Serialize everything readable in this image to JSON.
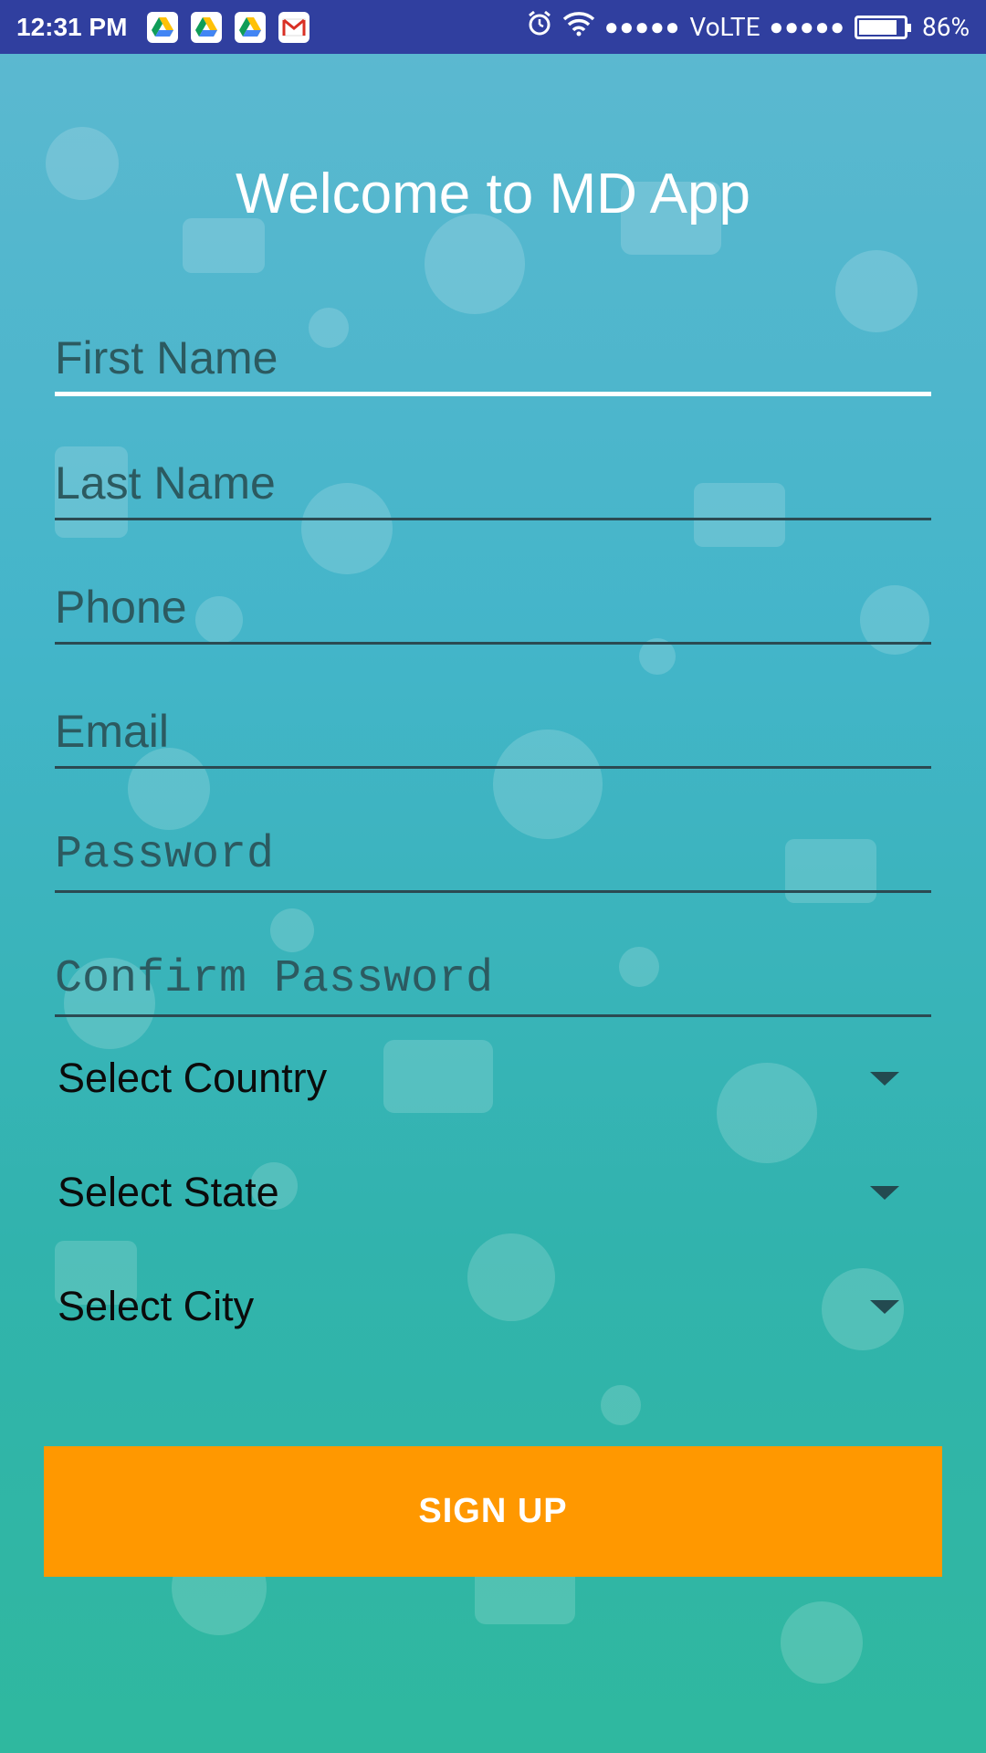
{
  "status_bar": {
    "time": "12:31 PM",
    "network": "VoLTE",
    "signal_dots_1": "●●●●●",
    "signal_dots_2": "●●●●●",
    "battery_percent": "86%",
    "battery_level": 0.86,
    "icons": [
      "drive-icon",
      "drive-icon",
      "drive-icon",
      "gmail-icon",
      "alarm-icon",
      "wifi-icon"
    ]
  },
  "welcome_title": "Welcome to MD App",
  "form": {
    "first_name_placeholder": "First Name",
    "last_name_placeholder": "Last Name",
    "phone_placeholder": "Phone",
    "email_placeholder": "Email",
    "password_placeholder": "Password",
    "confirm_password_placeholder": "Confirm Password",
    "country_label": "Select Country",
    "state_label": "Select State",
    "city_label": "Select City",
    "signup_label": "SIGN UP"
  },
  "colors": {
    "status_bar": "#303F9F",
    "accent_button": "#FF9800",
    "background_top": "#5bb8d0",
    "background_bottom": "#2fb89f"
  }
}
